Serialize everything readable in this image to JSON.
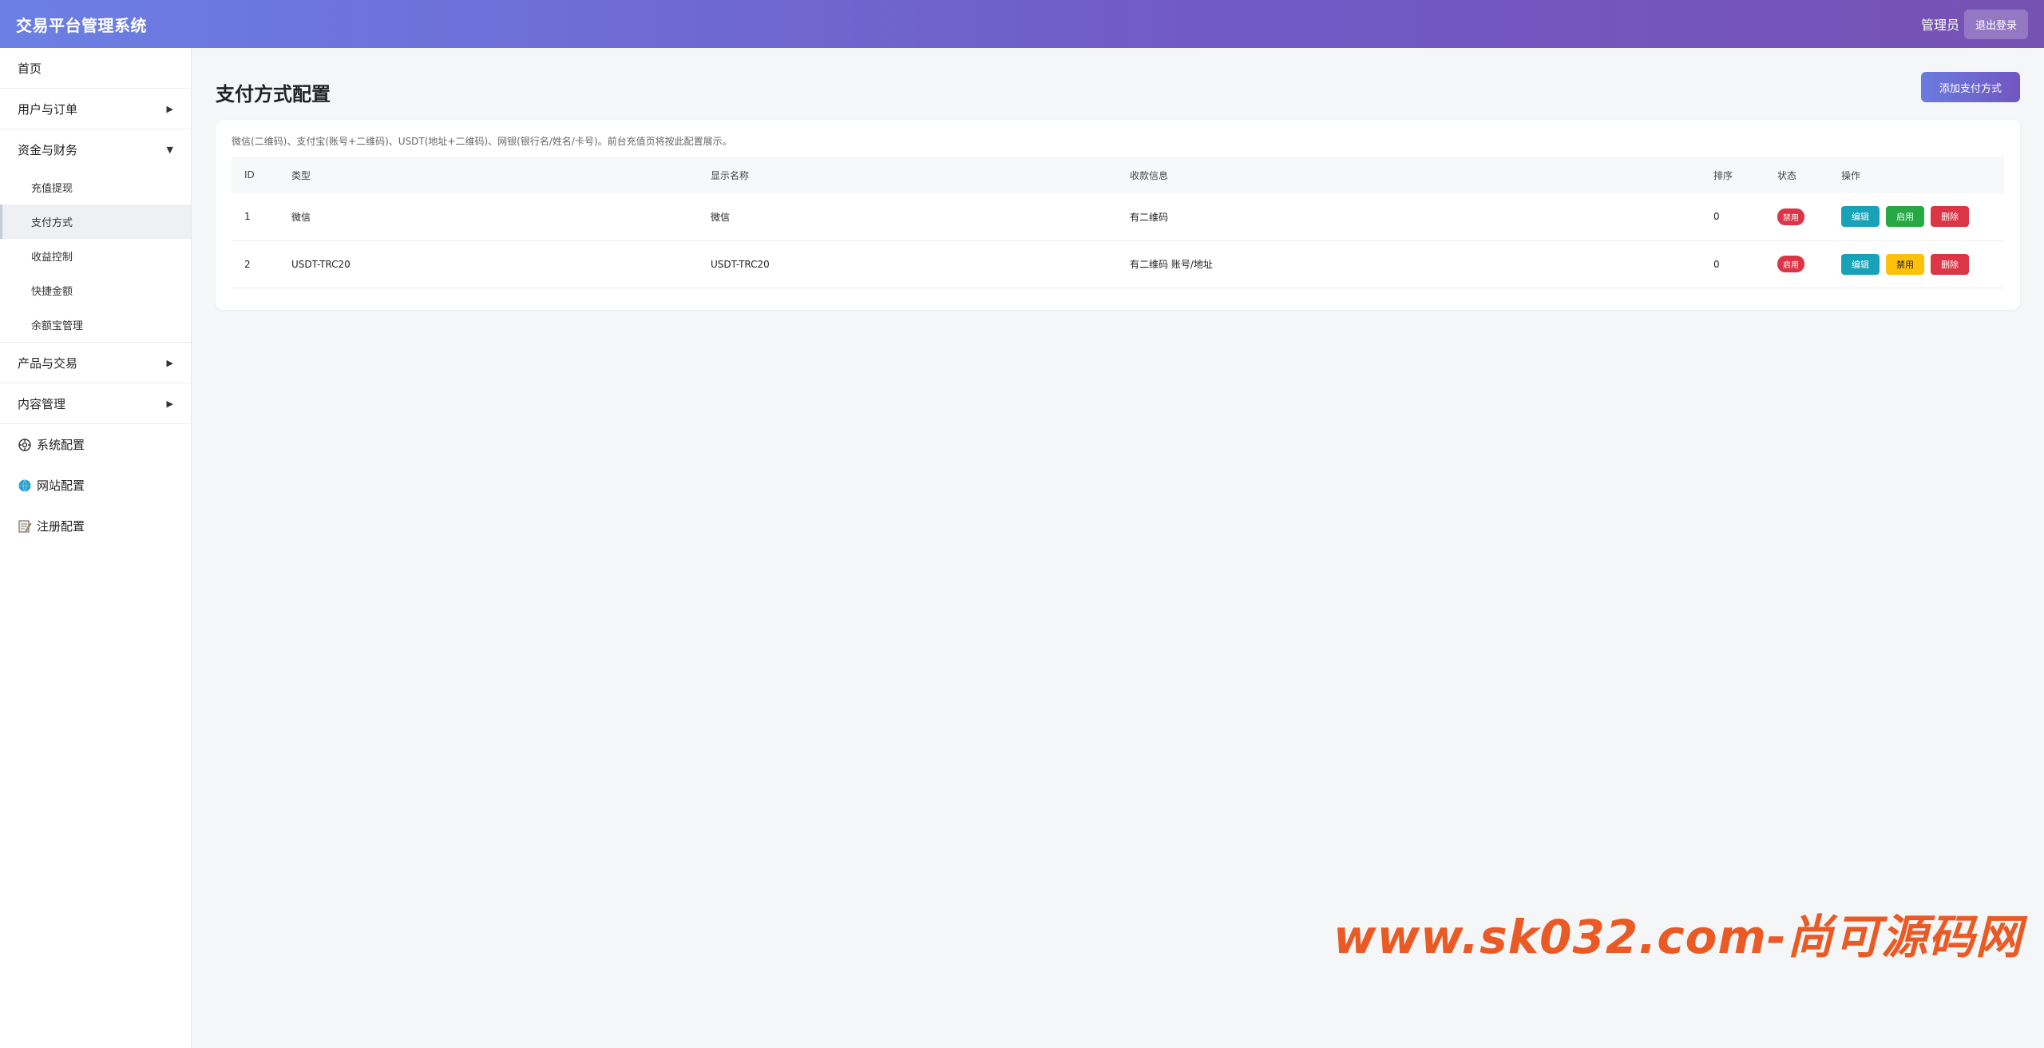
{
  "header": {
    "app_title": "交易平台管理系统",
    "user_name": "管理员",
    "logout_label": "退出登录"
  },
  "sidebar": {
    "home": "首页",
    "group_users": "用户与订单",
    "group_finance": "资金与财务",
    "finance_items": [
      "充值提现",
      "支付方式",
      "收益控制",
      "快捷金额",
      "余额宝管理"
    ],
    "group_products": "产品与交易",
    "group_content": "内容管理",
    "system_config": "系统配置",
    "site_config": "网站配置",
    "register_config": "注册配置",
    "caret_collapsed": "▶",
    "caret_expanded": "▼"
  },
  "main": {
    "page_title": "支付方式配置",
    "add_button": "添加支付方式",
    "notice": "微信(二维码)、支付宝(账号+二维码)、USDT(地址+二维码)、网银(银行名/姓名/卡号)。前台充值页将按此配置展示。",
    "columns": [
      "ID",
      "类型",
      "显示名称",
      "收款信息",
      "排序",
      "状态",
      "操作"
    ],
    "rows": [
      {
        "id": "1",
        "type": "微信",
        "display_name": "微信",
        "info": "有二维码",
        "sort": "0",
        "status": "禁用",
        "toggle_label": "启用"
      },
      {
        "id": "2",
        "type": "USDT-TRC20",
        "display_name": "USDT-TRC20",
        "info": "有二维码 账号/地址",
        "sort": "0",
        "status": "启用",
        "toggle_label": "禁用"
      }
    ],
    "edit_label": "编辑",
    "delete_label": "删除"
  },
  "watermark": "www.sk032.com-尚可源码网",
  "colors": {
    "header_start": "#6b7fe3",
    "header_end": "#7652b3",
    "edit": "#17a2b8",
    "enable": "#28a745",
    "disable": "#ffc107",
    "delete": "#dc3545",
    "watermark": "#ea5a24"
  }
}
